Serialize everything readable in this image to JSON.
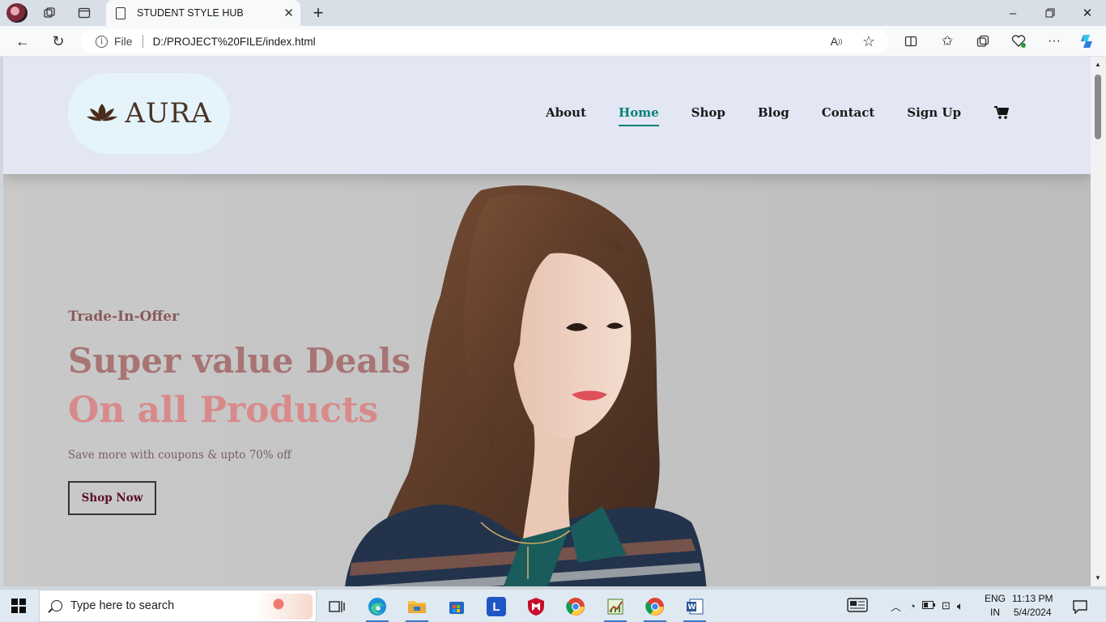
{
  "browser": {
    "tab_title": "STUDENT STYLE HUB",
    "address_prefix": "File",
    "url": "D:/PROJECT%20FILE/index.html"
  },
  "site": {
    "logo_text": "AURA",
    "nav": [
      {
        "label": "About"
      },
      {
        "label": "Home",
        "active": true
      },
      {
        "label": "Shop"
      },
      {
        "label": "Blog"
      },
      {
        "label": "Contact"
      },
      {
        "label": "Sign Up"
      }
    ],
    "cart_icon": "cart-icon"
  },
  "hero": {
    "eyebrow": "Trade-In-Offer",
    "headline_1": "Super value Deals",
    "headline_2": "On all Products",
    "subtext": "Save more with coupons & upto 70% off",
    "cta_label": "Shop Now"
  },
  "taskbar": {
    "search_placeholder": "Type here to search",
    "lang_top": "ENG",
    "lang_bottom": "IN",
    "time": "11:13 PM",
    "date": "5/4/2024"
  },
  "colors": {
    "header_bg": "#e3e6f3",
    "nav_active": "#088178",
    "headline_1": "#a87474",
    "headline_2": "#d88a8a",
    "cta_text": "#5a0f2a"
  }
}
